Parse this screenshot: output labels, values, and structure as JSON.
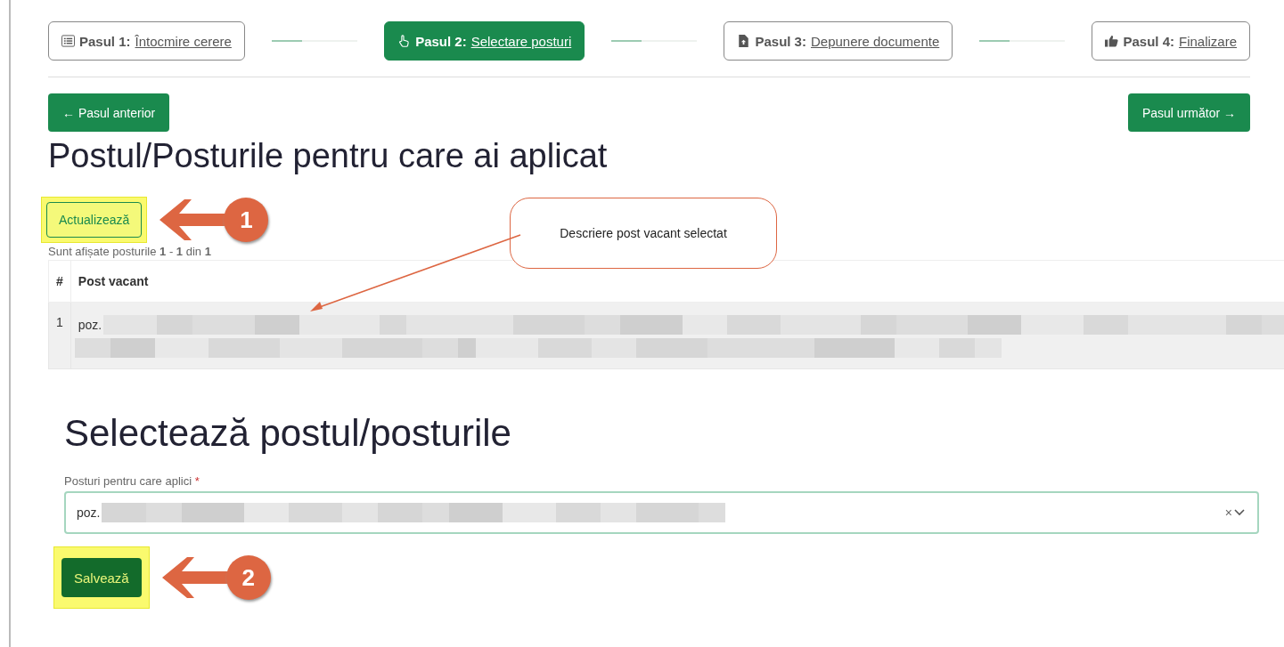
{
  "steps": [
    {
      "kind": "list",
      "prefix": "Pasul 1:",
      "link": "Întocmire cerere",
      "selected": false
    },
    {
      "kind": "pointer",
      "prefix": "Pasul 2:",
      "link": "Selectare posturi",
      "selected": true
    },
    {
      "kind": "upload",
      "prefix": "Pasul 3:",
      "link": "Depunere documente",
      "selected": false
    },
    {
      "kind": "thumb",
      "prefix": "Pasul 4:",
      "link": "Finalizare",
      "selected": false
    }
  ],
  "nav": {
    "previous": "← Pasul anterior",
    "next": "Pasul următor →"
  },
  "applied": {
    "title": "Postul/Posturile pentru care ai aplicat",
    "refresh_button": "Actualizează",
    "summary": "Sunt afișate posturile **1** - **1** din **1**",
    "columns": [
      "#",
      "Post vacant"
    ],
    "rows": [
      {
        "number": "1",
        "text": "poz."
      }
    ]
  },
  "callout": "Descriere post vacant selectat",
  "select_section": {
    "title": "Selectează postul/posturile",
    "label": "Posturi pentru care aplici",
    "required_mark": "*",
    "value": "poz.",
    "clear": "×"
  },
  "save_button": "Salvează",
  "annotations": [
    {
      "number": "1"
    },
    {
      "number": "2"
    }
  ]
}
